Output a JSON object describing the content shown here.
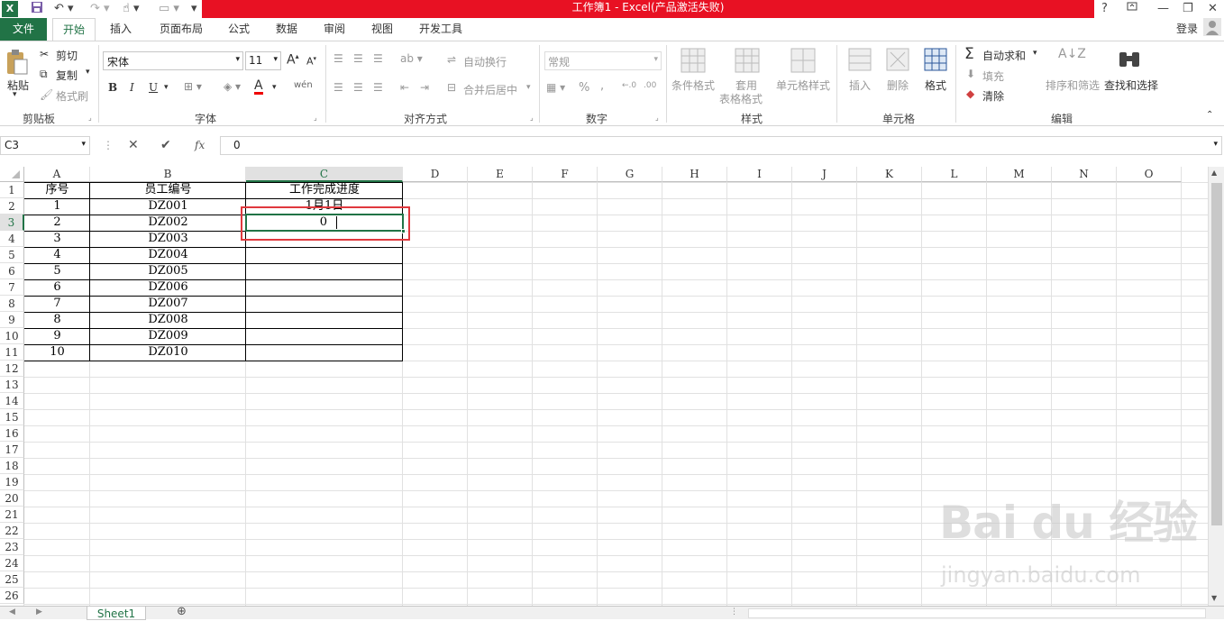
{
  "window": {
    "title": "工作簿1 -   Excel(产品激活失败)",
    "help": "?",
    "close_symbol": "✕"
  },
  "tabs": {
    "file": "文件",
    "home": "开始",
    "insert": "插入",
    "layout": "页面布局",
    "formulas": "公式",
    "data": "数据",
    "review": "审阅",
    "view": "视图",
    "developer": "开发工具",
    "login": "登录"
  },
  "clipboard": {
    "paste": "粘贴",
    "cut": "剪切",
    "copy": "复制",
    "format_painter": "格式刷",
    "group": "剪贴板"
  },
  "font": {
    "name": "宋体",
    "size": "11",
    "bold": "B",
    "italic": "I",
    "underline": "U",
    "font_color": "A",
    "phonetic": "wén",
    "group": "字体"
  },
  "alignment": {
    "wrap": "自动换行",
    "merge": "合并后居中",
    "group": "对齐方式"
  },
  "number": {
    "format": "常规",
    "percent": "%",
    "comma": ",",
    "group": "数字"
  },
  "styles": {
    "conditional": "条件格式",
    "table1": "套用",
    "table2": "表格格式",
    "cell_styles": "单元格样式",
    "group": "样式"
  },
  "cells": {
    "insert": "插入",
    "delete": "删除",
    "format": "格式",
    "group": "单元格"
  },
  "editing": {
    "autosum": "自动求和",
    "fill": "填充",
    "clear": "清除",
    "sort": "排序和筛选",
    "find": "查找和选择",
    "group": "编辑"
  },
  "formula_bar": {
    "name_box": "C3",
    "fx": "fx",
    "content": "0"
  },
  "columns": [
    "A",
    "B",
    "C",
    "D",
    "E",
    "F",
    "G",
    "H",
    "I",
    "J",
    "K",
    "L",
    "M",
    "N",
    "O"
  ],
  "rows": [
    "1",
    "2",
    "3",
    "4",
    "5",
    "6",
    "7",
    "8",
    "9",
    "10",
    "11",
    "12",
    "13",
    "14",
    "15",
    "16",
    "17",
    "18",
    "19",
    "20",
    "21",
    "22",
    "23",
    "24",
    "25",
    "26"
  ],
  "table": {
    "header": [
      "序号",
      "员工编号",
      "工作完成进度"
    ],
    "data": [
      [
        "1",
        "DZ001",
        "1月1日"
      ],
      [
        "2",
        "DZ002",
        "0"
      ],
      [
        "3",
        "DZ003",
        ""
      ],
      [
        "4",
        "DZ004",
        ""
      ],
      [
        "5",
        "DZ005",
        ""
      ],
      [
        "6",
        "DZ006",
        ""
      ],
      [
        "7",
        "DZ007",
        ""
      ],
      [
        "8",
        "DZ008",
        ""
      ],
      [
        "9",
        "DZ009",
        ""
      ],
      [
        "10",
        "DZ010",
        ""
      ]
    ]
  },
  "sheet_tab": "Sheet1",
  "watermark": {
    "text": "Bai du 经验",
    "url": "jingyan.baidu.com"
  },
  "colors": {
    "title_red": "#e81123",
    "excel_green": "#217346",
    "selection_green": "#217346",
    "highlight_red": "#e0393e"
  }
}
